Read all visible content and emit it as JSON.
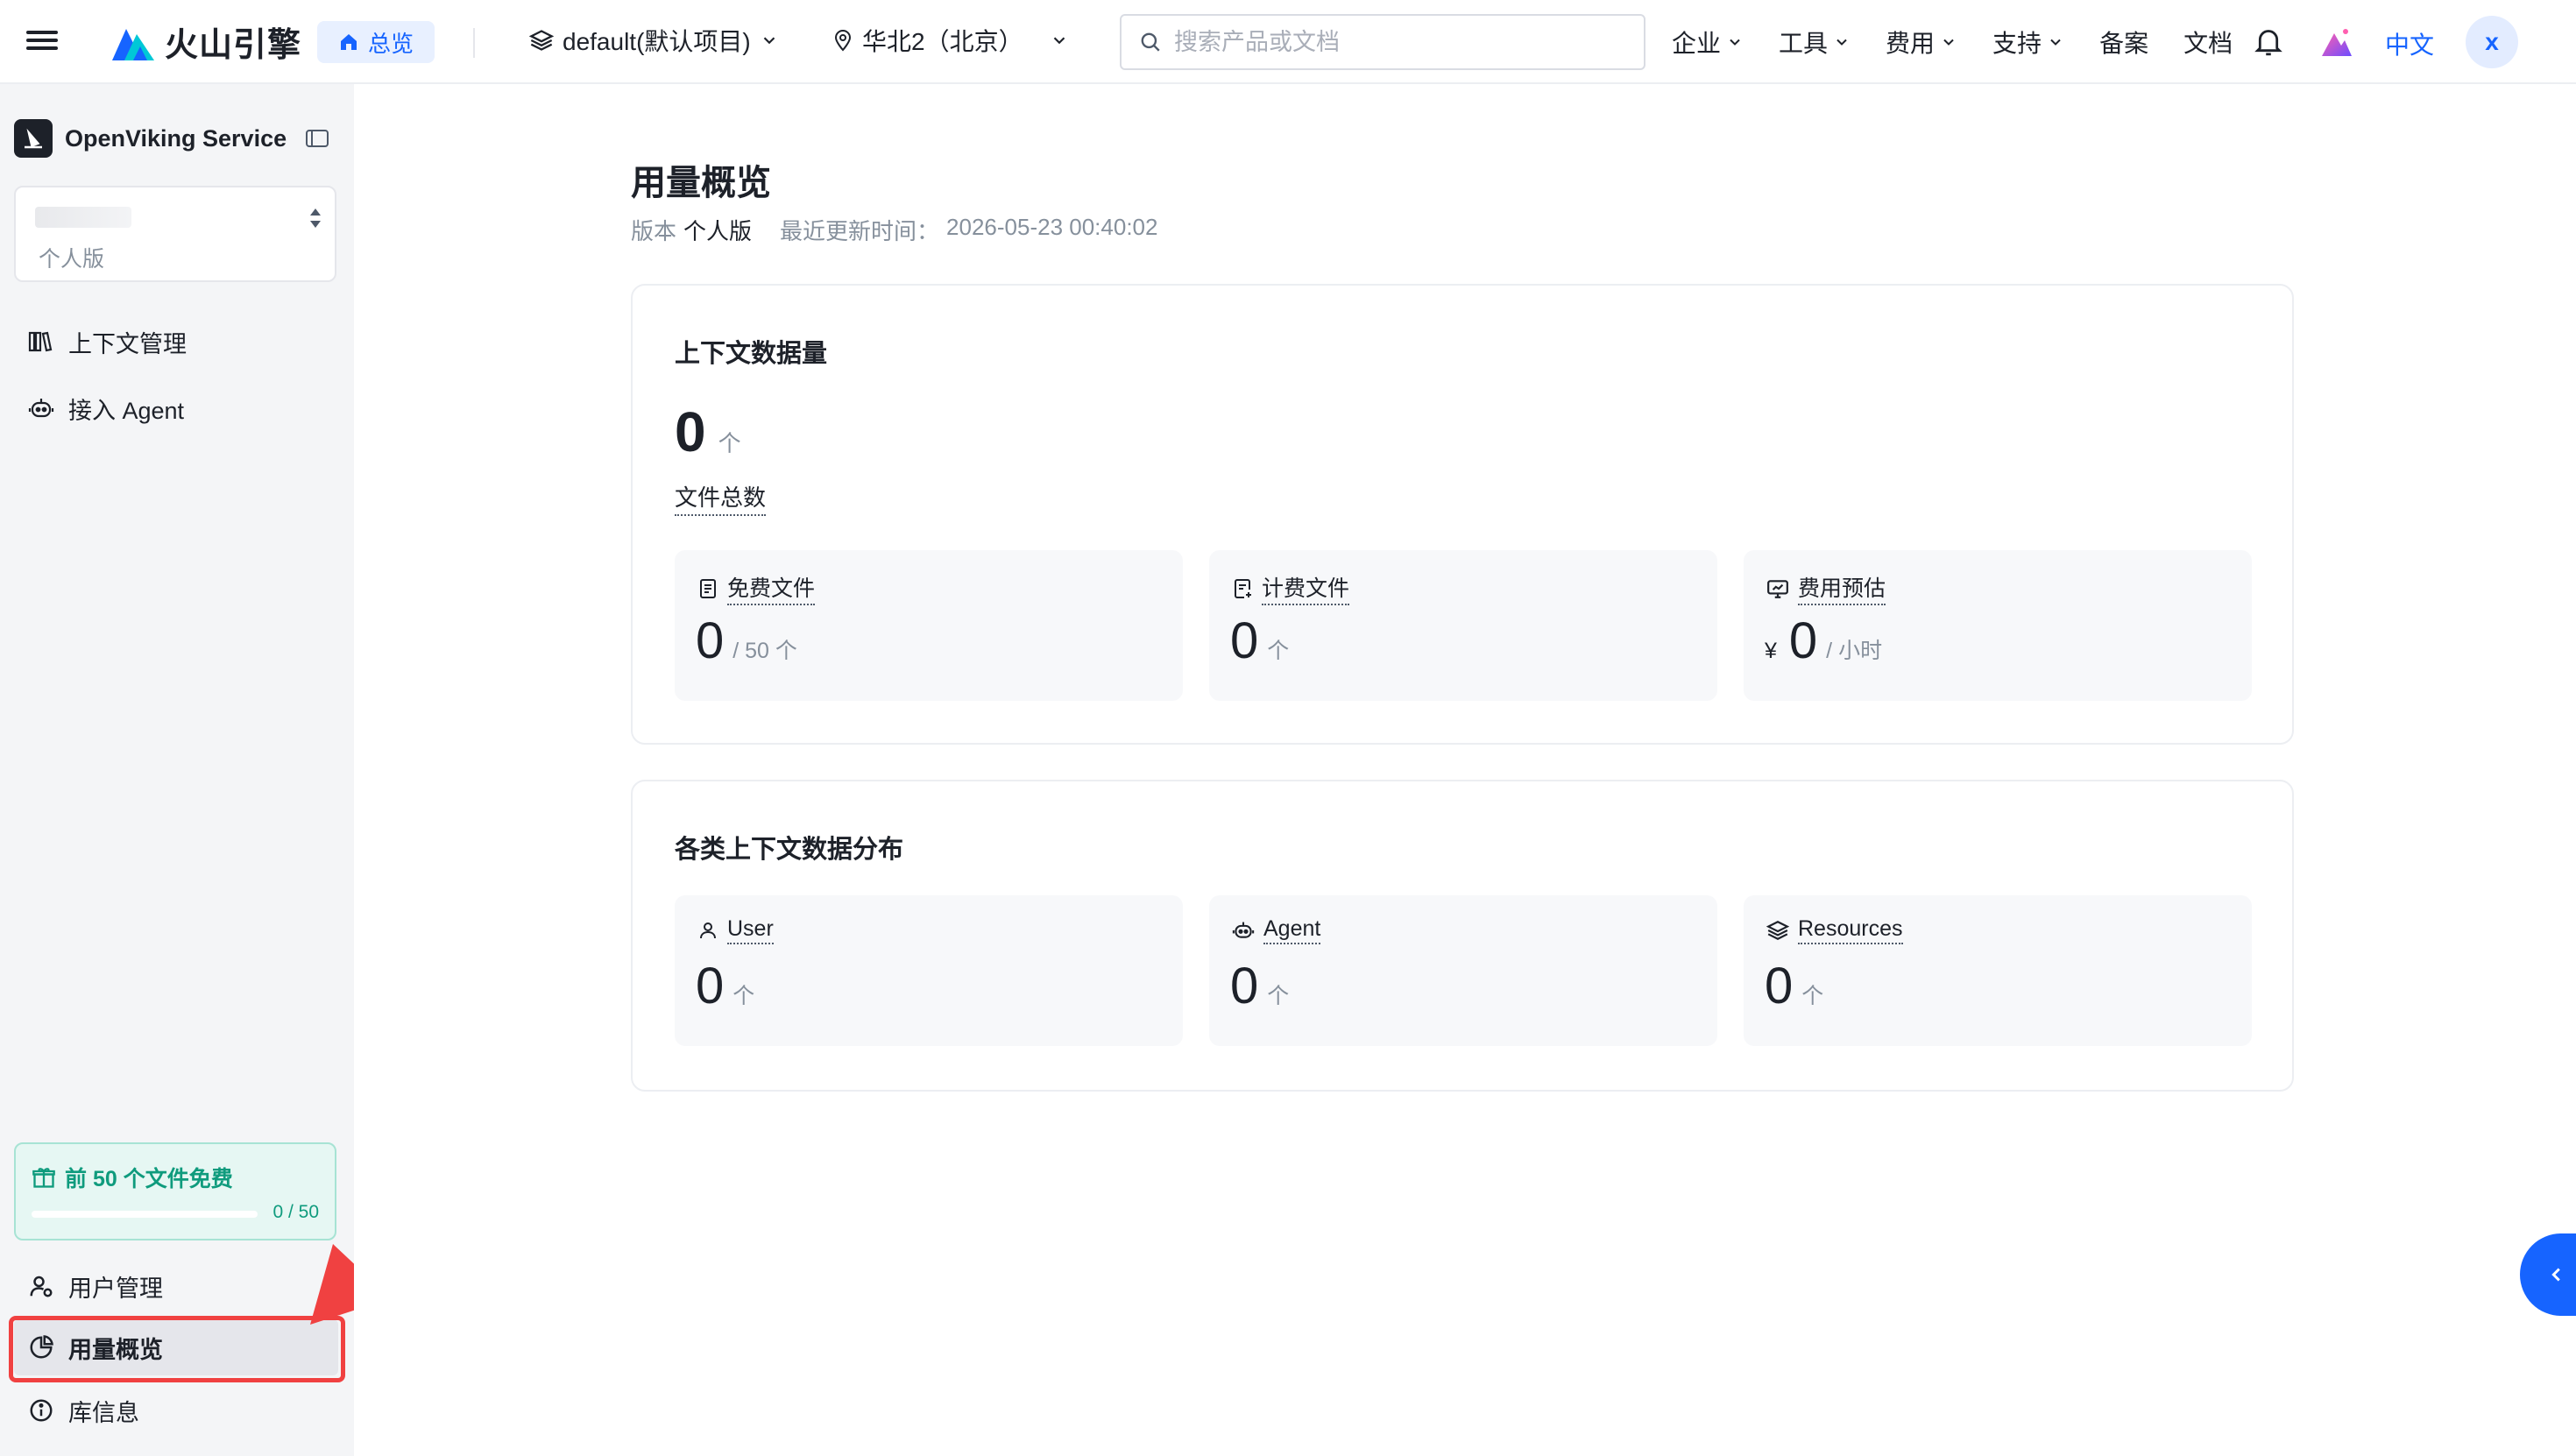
{
  "topbar": {
    "brand": "火山引擎",
    "home_label": "总览",
    "project": "default(默认项目)",
    "region": "华北2（北京）",
    "search_placeholder": "搜索产品或文档",
    "nav": [
      {
        "label": "企业",
        "dropdown": true
      },
      {
        "label": "工具",
        "dropdown": true
      },
      {
        "label": "费用",
        "dropdown": true
      },
      {
        "label": "支持",
        "dropdown": true
      },
      {
        "label": "备案",
        "dropdown": false
      },
      {
        "label": "文档",
        "dropdown": false
      }
    ],
    "language": "中文",
    "avatar_letter": "x"
  },
  "sidebar": {
    "service_name": "OpenViking Service",
    "instance_edition": "个人版",
    "menu_top": [
      {
        "label": "上下文管理",
        "icon": "books-icon"
      },
      {
        "label": "接入 Agent",
        "icon": "robot-icon"
      }
    ],
    "free_banner": {
      "title": "前 50 个文件免费",
      "count": "0 / 50",
      "progress": 0
    },
    "menu_bottom": [
      {
        "label": "用户管理",
        "icon": "user-settings-icon",
        "active": false
      },
      {
        "label": "用量概览",
        "icon": "pie-chart-icon",
        "active": true
      },
      {
        "label": "库信息",
        "icon": "info-icon",
        "active": false
      }
    ]
  },
  "main": {
    "title": "用量概览",
    "edition_label": "版本",
    "edition_value": "个人版",
    "updated_label": "最近更新时间：",
    "updated_value": "2026-05-23 00:40:02",
    "volume_card": {
      "title": "上下文数据量",
      "total_value": "0",
      "total_unit": "个",
      "total_label": "文件总数",
      "stats": [
        {
          "label": "免费文件",
          "icon": "doc-icon",
          "value": "0",
          "unit": "/ 50 个",
          "currency": ""
        },
        {
          "label": "计费文件",
          "icon": "doc-billing-icon",
          "value": "0",
          "unit": "个",
          "currency": ""
        },
        {
          "label": "费用预估",
          "icon": "monitor-icon",
          "value": "0",
          "unit": "/ 小时",
          "currency": "¥"
        }
      ]
    },
    "dist_card": {
      "title": "各类上下文数据分布",
      "stats": [
        {
          "label": "User",
          "icon": "user-icon",
          "value": "0",
          "unit": "个"
        },
        {
          "label": "Agent",
          "icon": "robot-icon",
          "value": "0",
          "unit": "个"
        },
        {
          "label": "Resources",
          "icon": "layers-icon",
          "value": "0",
          "unit": "个"
        }
      ]
    }
  },
  "colors": {
    "accent": "#1664ff",
    "free_green": "#0f9b7d",
    "highlight_red": "#f04141"
  }
}
